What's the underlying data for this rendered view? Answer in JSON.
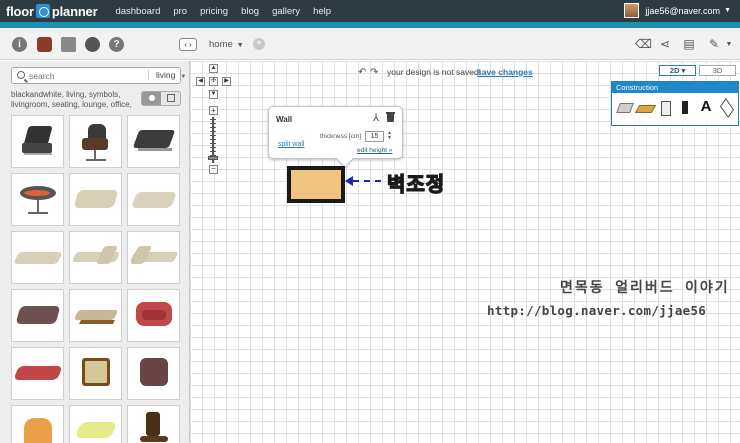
{
  "app": {
    "logo_left": "floor",
    "logo_right": "planner"
  },
  "nav": {
    "items": [
      "dashboard",
      "pro",
      "pricing",
      "blog",
      "gallery",
      "help"
    ]
  },
  "user": {
    "email": "jjae56@naver.com"
  },
  "toolbar": {
    "info_glyph": "i",
    "help_glyph": "?",
    "toggle_glyph": "‹ ›",
    "breadcrumb": "home"
  },
  "sidebar": {
    "search_placeholder": "search",
    "category": "living",
    "tags": "blackandwhite, living, symbols, livingroom, seating, lounge, office,",
    "items": [
      "leather-lounge-chair",
      "eames-lounge-chair",
      "modern-lounge-chair",
      "round-lounge-chair",
      "beige-sofa",
      "beige-loveseat",
      "beige-long-sofa",
      "beige-corner-sofa",
      "beige-l-sofa",
      "brown-sofa",
      "wood-chaise",
      "red-armchair",
      "red-long-sofa",
      "wooden-armchair",
      "maroon-armchair",
      "orange-tub-chair",
      "lime-chaise",
      "wood-rocking-chair"
    ]
  },
  "canvas": {
    "undo_glyph": "↶",
    "redo_glyph": "↷",
    "save_message": "your design is not saved!",
    "save_link": "save changes",
    "view_2d": "2D ▾",
    "view_3d": "3D",
    "construction_title": "Construction",
    "construction_text_tool": "A"
  },
  "wall_popup": {
    "title": "Wall",
    "thickness_label": "thickness [cm]",
    "thickness_value": "15",
    "split_link": "split wall",
    "edit_height_link": "edit height »"
  },
  "annotation": {
    "label": "벽조정"
  },
  "watermark": {
    "name": "면목동 얼리버드 이야기",
    "url": "http://blog.naver.com/jjae56"
  },
  "colors": {
    "topbar": "#2f3b43",
    "accent": "#1d8fb0",
    "link": "#2b7bbf",
    "wall_fill": "#f0c480",
    "annotation_text": "#f7e63a",
    "annotation_arrow": "#1a2aa8"
  }
}
